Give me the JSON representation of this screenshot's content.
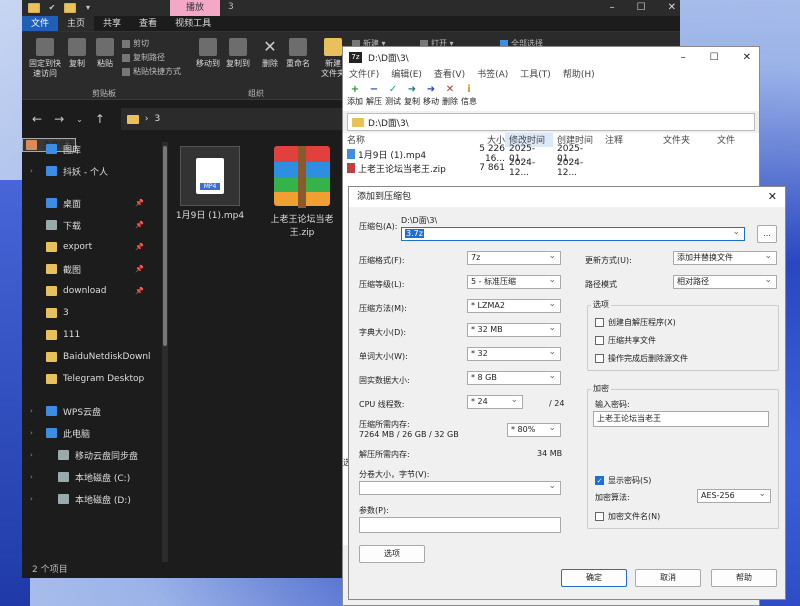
{
  "explorer": {
    "title_tab": "播放",
    "title_num": "3",
    "tabs": [
      "文件",
      "主页",
      "共享",
      "查看",
      "视频工具"
    ],
    "ribbon": {
      "pin": "固定到快\n速访问",
      "copy": "复制",
      "paste": "粘贴",
      "cut": "剪切",
      "copy_path": "复制路径",
      "paste_shortcut": "粘贴快捷方式",
      "move_to": "移动到",
      "copy_to": "复制到",
      "delete": "删除",
      "rename": "重命名",
      "new_folder": "新建\n文件夹",
      "new_item": "新建 ▾",
      "open": "打开 ▾",
      "select_all": "全部选择",
      "clipboard_group": "剪贴板",
      "organize_group": "组织"
    },
    "address": "3",
    "nav": [
      {
        "label": "主文件夹",
        "icon": "home-icon",
        "pin": false
      },
      {
        "label": "图库",
        "icon": "gallery-icon",
        "pin": false
      },
      {
        "label": "抖妖 - 个人",
        "icon": "cloud-icon",
        "pin": false
      },
      {
        "label": "桌面",
        "icon": "desktop-icon",
        "pin": true
      },
      {
        "label": "下载",
        "icon": "download-icon",
        "pin": true
      },
      {
        "label": "export",
        "icon": "folder-icon",
        "pin": true
      },
      {
        "label": "截图",
        "icon": "folder-icon",
        "pin": true
      },
      {
        "label": "download",
        "icon": "folder-icon",
        "pin": true
      },
      {
        "label": "3",
        "icon": "folder-icon",
        "pin": false
      },
      {
        "label": "111",
        "icon": "folder-icon",
        "pin": false
      },
      {
        "label": "BaiduNetdiskDownl",
        "icon": "folder-icon",
        "pin": false
      },
      {
        "label": "Telegram Desktop",
        "icon": "folder-icon",
        "pin": false
      },
      {
        "label": "WPS云盘",
        "icon": "cloud-icon",
        "pin": false
      },
      {
        "label": "此电脑",
        "icon": "pc-icon",
        "pin": false
      },
      {
        "label": "移动云盘同步盘",
        "icon": "drive-icon",
        "pin": false
      },
      {
        "label": "本地磁盘 (C:)",
        "icon": "drive-icon",
        "pin": false
      },
      {
        "label": "本地磁盘 (D:)",
        "icon": "drive-icon",
        "pin": false
      }
    ],
    "files": [
      {
        "name": "1月9日 (1).mp4",
        "badge": "MP4"
      },
      {
        "name": "上老王论坛当老\n王.zip"
      }
    ],
    "status": "2 个项目"
  },
  "sevenzip": {
    "title": "D:\\D面\\3\\",
    "logo": "7z",
    "menu": [
      "文件(F)",
      "编辑(E)",
      "查看(V)",
      "书签(A)",
      "工具(T)",
      "帮助(H)"
    ],
    "toolbar": [
      "添加",
      "解压",
      "测试",
      "复制",
      "移动",
      "删除",
      "信息"
    ],
    "path": "D:\\D面\\3\\",
    "columns": [
      "名称",
      "大小",
      "修改时间",
      "创建时间",
      "注释",
      "文件夹",
      "文件"
    ],
    "rows": [
      {
        "name": "1月9日 (1).mp4",
        "size": "5 226 16...",
        "mtime": "2025-01...",
        "ctime": "2025-01..."
      },
      {
        "name": "上老王论坛当老王.zip",
        "size": "7 861",
        "mtime": "2024-12...",
        "ctime": "2024-12..."
      }
    ],
    "side_char": "选"
  },
  "dialog": {
    "title": "添加到压缩包",
    "archive_label": "压缩包(A):",
    "archive_dir": "D:\\D面\\3\\",
    "archive_name": "3.7z",
    "browse": "...",
    "format_label": "压缩格式(F):",
    "format": "7z",
    "level_label": "压缩等级(L):",
    "level": "5 - 标准压缩",
    "method_label": "压缩方法(M):",
    "method": "* LZMA2",
    "dict_label": "字典大小(D):",
    "dict": "* 32 MB",
    "word_label": "单词大小(W):",
    "word": "* 32",
    "solid_label": "固实数据大小:",
    "solid": "* 8 GB",
    "cpu_label": "CPU 线程数:",
    "cpu": "* 24",
    "cpu_total": "/ 24",
    "mem_comp_label": "压缩所需内存:",
    "mem_comp_detail": "7264 MB / 26 GB / 32 GB",
    "mem_comp": "* 80%",
    "mem_decomp_label": "解压所需内存:",
    "mem_decomp": "34 MB",
    "split_label": "分卷大小，字节(V):",
    "params_label": "参数(P):",
    "options_button": "选项",
    "update_label": "更新方式(U):",
    "update": "添加并替换文件",
    "path_label": "路径模式",
    "path_mode": "相对路径",
    "options_group": "选项",
    "opt_sfx": "创建自解压程序(X)",
    "opt_shared": "压缩共享文件",
    "opt_delete": "操作完成后删除源文件",
    "encrypt_group": "加密",
    "password_label": "输入密码:",
    "password": "上老王论坛当老王",
    "show_password": "显示密码(S)",
    "enc_method_label": "加密算法:",
    "enc_method": "AES-256",
    "encrypt_names": "加密文件名(N)",
    "ok": "确定",
    "cancel": "取消",
    "help": "帮助"
  }
}
